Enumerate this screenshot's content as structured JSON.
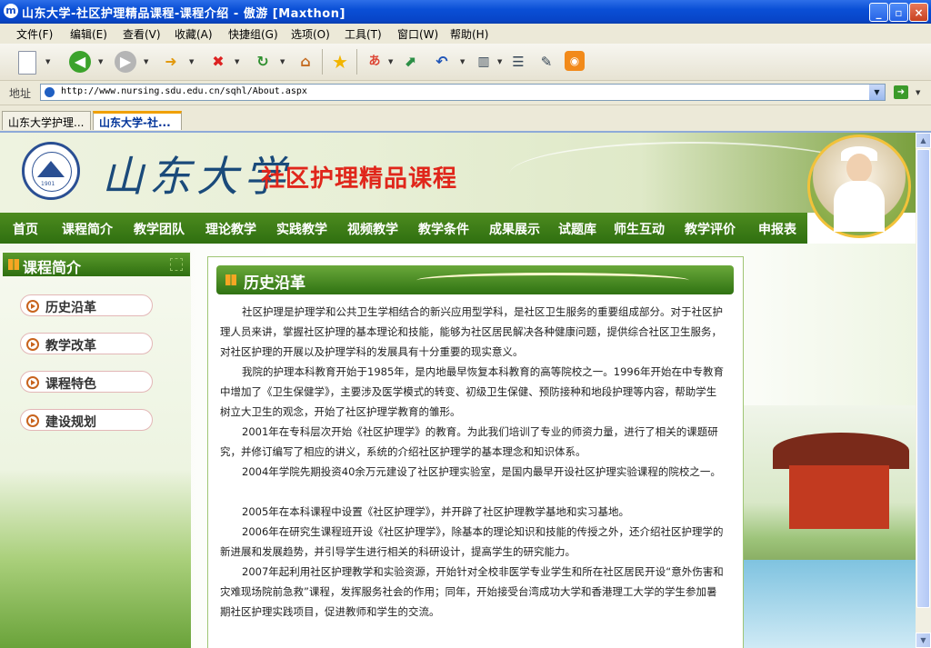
{
  "window": {
    "app_icon": "m",
    "title": "山东大学-社区护理精品课程-课程介绍 - 傲游 [Maxthon]",
    "controls": [
      "minimize-icon",
      "maximize-icon",
      "close-icon"
    ]
  },
  "menu": [
    "文件(F)",
    "编辑(E)",
    "查看(V)",
    "收藏(A)",
    "快捷组(G)",
    "选项(O)",
    "工具(T)",
    "窗口(W)",
    "帮助(H)"
  ],
  "toolbar": {
    "icons": [
      "new-page-icon",
      "back-icon",
      "forward-icon",
      "up-folder-icon",
      "stop-icon",
      "refresh-icon",
      "home-icon",
      "favorites-star-icon",
      "translate-icon",
      "fullscreen-icon",
      "undo-icon",
      "columns-icon",
      "list-icon",
      "edit-icon",
      "rss-icon"
    ]
  },
  "address": {
    "label": "地址",
    "url": "http://www.nursing.sdu.edu.cn/sqhl/About.aspx"
  },
  "tabs": [
    {
      "label": "山东大学护理...",
      "active": false
    },
    {
      "label": "山东大学-社...",
      "active": true
    }
  ],
  "site": {
    "calligraphy": "山东大学",
    "course_title": "社区护理精品课程",
    "logo_year": "1901",
    "nav": [
      "首页",
      "课程简介",
      "教学团队",
      "理论教学",
      "实践教学",
      "视频教学",
      "教学条件",
      "成果展示",
      "试题库",
      "师生互动",
      "教学评价",
      "申报表"
    ]
  },
  "sidebar": {
    "heading": "课程简介",
    "items": [
      "历史沿革",
      "教学改革",
      "课程特色",
      "建设规划"
    ]
  },
  "article": {
    "heading": "历史沿革",
    "paragraphs": [
      "社区护理是护理学和公共卫生学相结合的新兴应用型学科，是社区卫生服务的重要组成部分。对于社区护理人员来讲，掌握社区护理的基本理论和技能，能够为社区居民解决各种健康问题，提供综合社区卫生服务，对社区护理的开展以及护理学科的发展具有十分重要的现实意义。",
      "我院的护理本科教育开始于1985年，是内地最早恢复本科教育的高等院校之一。1996年开始在中专教育中增加了《卫生保健学》，主要涉及医学模式的转变、初级卫生保健、预防接种和地段护理等内容，帮助学生树立大卫生的观念，开始了社区护理学教育的雏形。",
      "2001年在专科层次开始《社区护理学》的教育。为此我们培训了专业的师资力量，进行了相关的课题研究，并修订编写了相应的讲义，系统的介绍社区护理学的基本理念和知识体系。",
      "2004年学院先期投资40余万元建设了社区护理实验室，是国内最早开设社区护理实验课程的院校之一。",
      "2005年在本科课程中设置《社区护理学》，并开辟了社区护理教学基地和实习基地。",
      "2006年在研究生课程班开设《社区护理学》，除基本的理论知识和技能的传授之外，还介绍社区护理学的新进展和发展趋势，并引导学生进行相关的科研设计，提高学生的研究能力。",
      "2007年起利用社区护理教学和实验资源，开始针对全校非医学专业学生和所在社区居民开设“意外伤害和灾难现场院前急救”课程，发挥服务社会的作用；同年，开始接受台湾成功大学和香港理工大学的学生参加暑期社区护理实践项目，促进教师和学生的交流。"
    ]
  }
}
